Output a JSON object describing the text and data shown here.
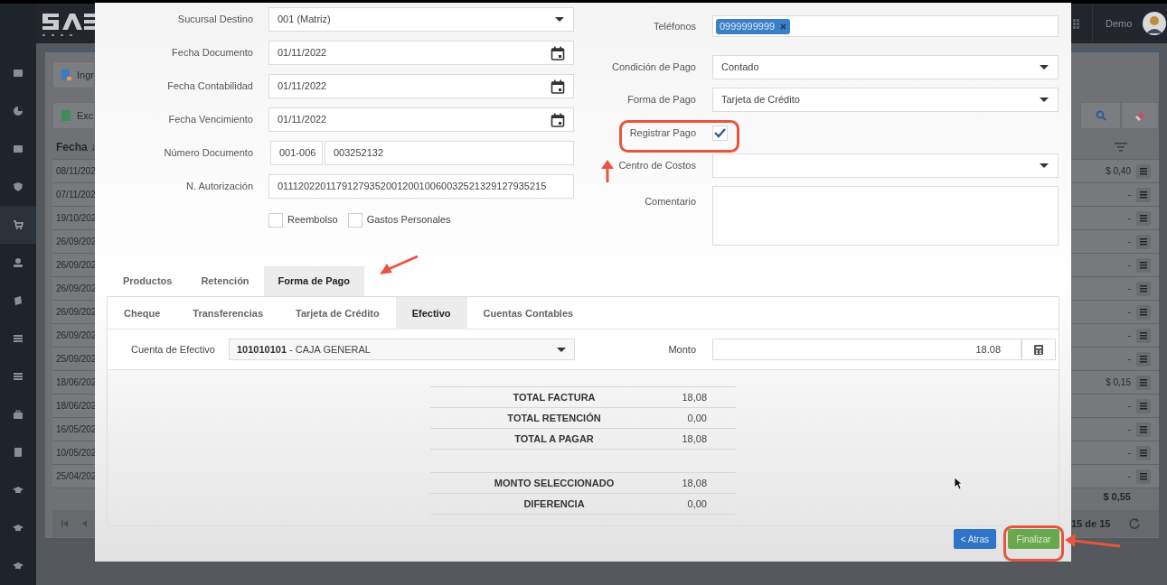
{
  "app_header": {
    "user": "Demo"
  },
  "background_toolbar": [
    "Ingr",
    "Exc"
  ],
  "background_table": {
    "column_1": "Fecha ↓",
    "rows": [
      {
        "column_1": "08/11/202",
        "column_2": "$ 0,40"
      },
      {
        "column_1": "07/11/202",
        "column_2": "-"
      },
      {
        "column_1": "19/10/202",
        "column_2": "-"
      },
      {
        "column_1": "26/09/202",
        "column_2": "-"
      },
      {
        "column_1": "26/09/202",
        "column_2": "-"
      },
      {
        "column_1": "26/09/202",
        "column_2": "-"
      },
      {
        "column_1": "26/09/202",
        "column_2": "-"
      },
      {
        "column_1": "26/09/202",
        "column_2": "-"
      },
      {
        "column_1": "25/09/202",
        "column_2": "-"
      },
      {
        "column_1": "18/06/202",
        "column_2": "$ 0,15"
      },
      {
        "column_1": "18/06/202",
        "column_2": "-"
      },
      {
        "column_1": "16/05/202",
        "column_2": "-"
      },
      {
        "column_1": "10/05/202",
        "column_2": "-"
      },
      {
        "column_1": "25/04/202",
        "column_2": "-"
      }
    ],
    "total": "$ 0,55",
    "pager": "15 de 15"
  },
  "dialog": {
    "left_fields": [
      {
        "kind": "select",
        "label": "Sucursal Destino",
        "value": "001 (Matriz)"
      },
      {
        "kind": "date",
        "label": "Fecha Documento",
        "value": "01/11/2022"
      },
      {
        "kind": "date",
        "label": "Fecha Contabilidad",
        "value": "01/11/2022"
      },
      {
        "kind": "date",
        "label": "Fecha Vencimiento",
        "value": "01/11/2022"
      },
      {
        "kind": "split",
        "label": "Número Documento",
        "values": [
          "001-006",
          "003252132"
        ]
      },
      {
        "kind": "text",
        "label": "N. Autorización",
        "value": "0111202201179127935200120010060032521329127935215"
      }
    ],
    "checkboxes": [
      {
        "label": "Reembolso",
        "checked": false
      },
      {
        "label": "Gastos Personales",
        "checked": false
      }
    ],
    "right_fields": [
      {
        "kind": "tags",
        "label": "Teléfonos",
        "tags": [
          "0999999999"
        ]
      },
      {
        "kind": "select",
        "label": "Condición de Pago",
        "value": "Contado"
      },
      {
        "kind": "select",
        "label": "Forma de Pago",
        "value": "Tarjeta de Crédito"
      },
      {
        "kind": "checkbox",
        "label": "Registrar Pago",
        "checked": true
      },
      {
        "kind": "select",
        "label": "Centro de Costos"
      },
      {
        "kind": "textarea",
        "label": "Comentario"
      }
    ],
    "tabs": [
      {
        "label": "Productos",
        "selected": false
      },
      {
        "label": "Retención",
        "selected": false
      },
      {
        "label": "Forma de Pago",
        "selected": true
      }
    ],
    "subtabs": [
      {
        "label": "Cheque",
        "selected": false
      },
      {
        "label": "Transferencias",
        "selected": false
      },
      {
        "label": "Tarjeta de Crédito",
        "selected": false
      },
      {
        "label": "Efectivo",
        "selected": true
      },
      {
        "label": "Cuentas Contables",
        "selected": false
      }
    ],
    "cash": {
      "label": "Cuenta de Efectivo",
      "account_code": "101010101",
      "account_name": "- CAJA GENERAL",
      "amount_label": "Monto",
      "amount": "18.08"
    },
    "totals_groups": [
      [
        {
          "label": "TOTAL FACTURA",
          "value": "18,08"
        },
        {
          "label": "TOTAL RETENCIÓN",
          "value": "0,00"
        },
        {
          "label": "TOTAL A PAGAR",
          "value": "18,08"
        }
      ],
      [
        {
          "label": "MONTO SELECCIONADO",
          "value": "18,08"
        },
        {
          "label": "DIFERENCIA",
          "value": "0,00"
        }
      ]
    ],
    "buttons": [
      {
        "label": "< Atras",
        "kind": "secondary"
      },
      {
        "label": "Finalizar",
        "kind": "primary"
      }
    ]
  }
}
